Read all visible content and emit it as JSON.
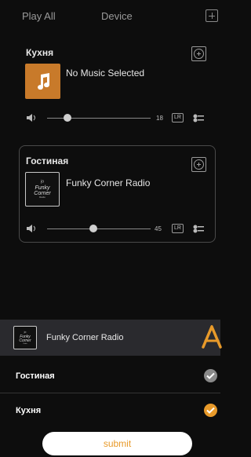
{
  "header": {
    "play_all": "Play All",
    "device": "Device"
  },
  "rooms": [
    {
      "name": "Кухня",
      "track": "No Music Selected",
      "volume": "18",
      "lr": "LR"
    },
    {
      "name": "Гостиная",
      "track": "Funky Corner Radio",
      "volume": "45",
      "lr": "LR"
    }
  ],
  "album_art": {
    "line1": "ʲᵒ",
    "line2": "Funky",
    "line3": "Corner",
    "line4": "Radio"
  },
  "now_playing": {
    "title": "Funky Corner Radio"
  },
  "device_list": [
    {
      "label": "Гостиная",
      "checked": true,
      "check_color": "#8a8a8a"
    },
    {
      "label": "Кухня",
      "checked": true,
      "check_color": "#e89a2a"
    }
  ],
  "submit_label": "submit",
  "colors": {
    "accent": "#e89a2a",
    "album_orange": "#c87a2a",
    "panel": "#2a2a2e"
  }
}
